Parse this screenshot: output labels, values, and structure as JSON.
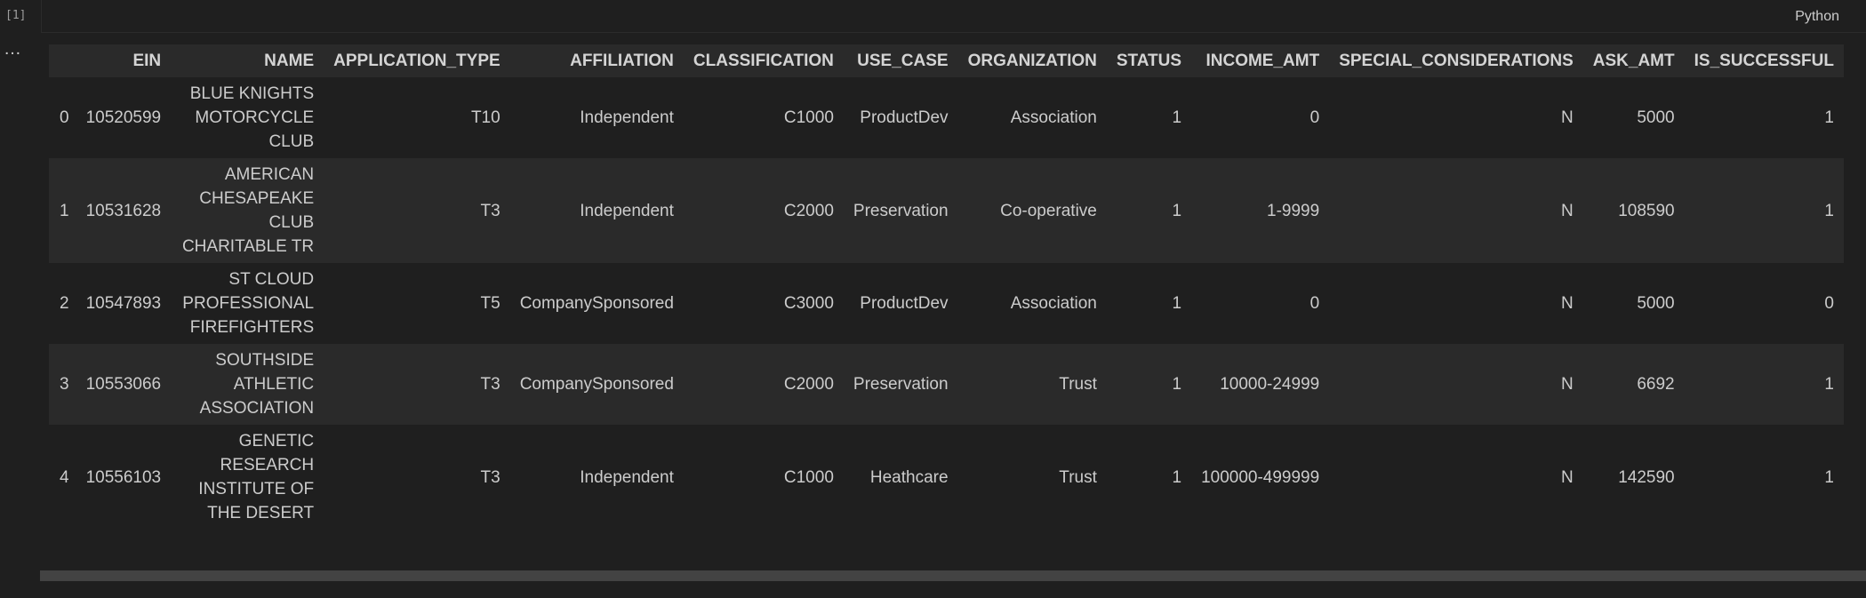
{
  "cell": {
    "exec_count": "[1]",
    "language": "Python",
    "more_glyph": "…"
  },
  "table": {
    "columns": [
      "",
      "EIN",
      "NAME",
      "APPLICATION_TYPE",
      "AFFILIATION",
      "CLASSIFICATION",
      "USE_CASE",
      "ORGANIZATION",
      "STATUS",
      "INCOME_AMT",
      "SPECIAL_CONSIDERATIONS",
      "ASK_AMT",
      "IS_SUCCESSFUL"
    ],
    "rows": [
      [
        "0",
        "10520599",
        "BLUE KNIGHTS MOTORCYCLE CLUB",
        "T10",
        "Independent",
        "C1000",
        "ProductDev",
        "Association",
        "1",
        "0",
        "N",
        "5000",
        "1"
      ],
      [
        "1",
        "10531628",
        "AMERICAN CHESAPEAKE CLUB CHARITABLE TR",
        "T3",
        "Independent",
        "C2000",
        "Preservation",
        "Co-operative",
        "1",
        "1-9999",
        "N",
        "108590",
        "1"
      ],
      [
        "2",
        "10547893",
        "ST CLOUD PROFESSIONAL FIREFIGHTERS",
        "T5",
        "CompanySponsored",
        "C3000",
        "ProductDev",
        "Association",
        "1",
        "0",
        "N",
        "5000",
        "0"
      ],
      [
        "3",
        "10553066",
        "SOUTHSIDE ATHLETIC ASSOCIATION",
        "T3",
        "CompanySponsored",
        "C2000",
        "Preservation",
        "Trust",
        "1",
        "10000-24999",
        "N",
        "6692",
        "1"
      ],
      [
        "4",
        "10556103",
        "GENETIC RESEARCH INSTITUTE OF THE DESERT",
        "T3",
        "Independent",
        "C1000",
        "Heathcare",
        "Trust",
        "1",
        "100000-499999",
        "N",
        "142590",
        "1"
      ]
    ]
  }
}
